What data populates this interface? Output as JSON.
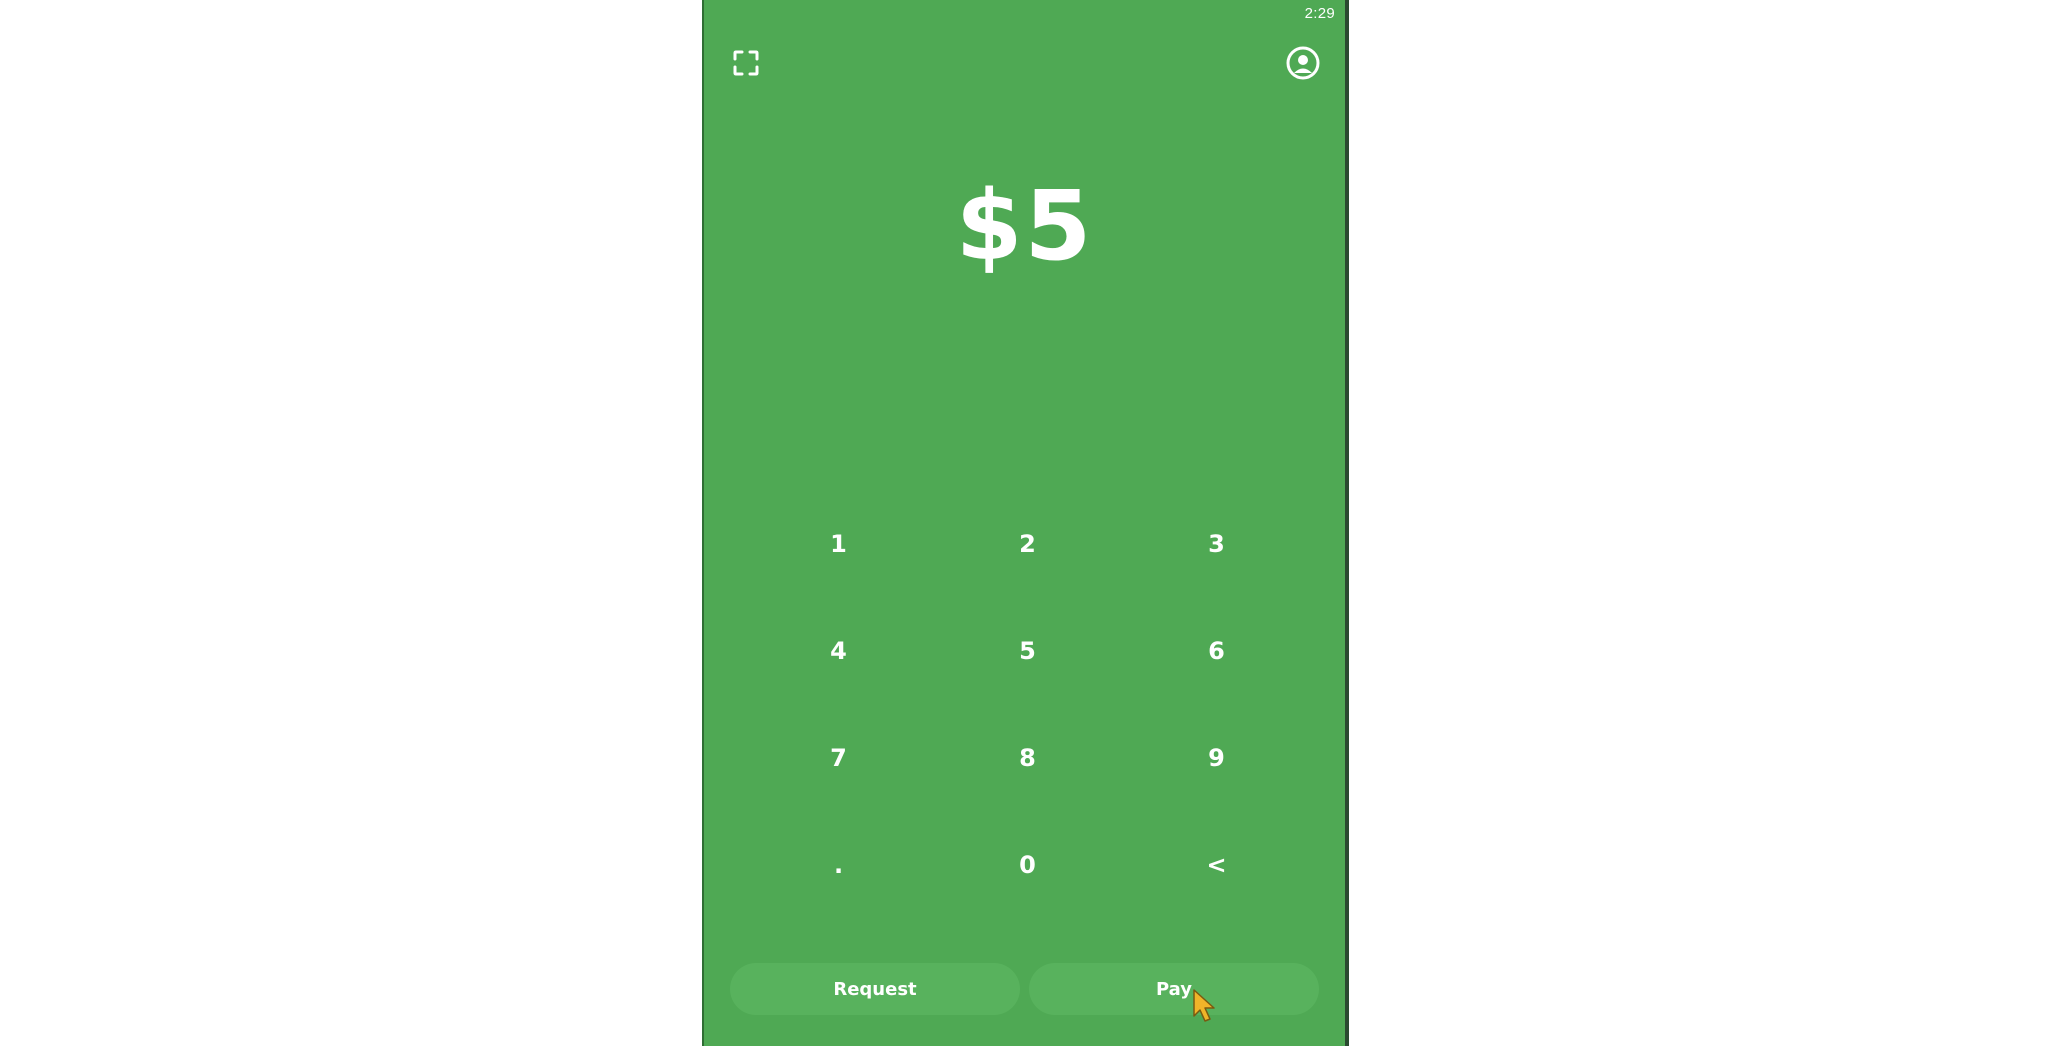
{
  "status_bar": {
    "time": "2:29"
  },
  "header": {
    "scan_icon": "scan-frame-icon",
    "profile_icon": "profile-circle-icon"
  },
  "amount": {
    "display": "$5"
  },
  "keypad": {
    "keys": [
      "1",
      "2",
      "3",
      "4",
      "5",
      "6",
      "7",
      "8",
      "9",
      ".",
      "0",
      "<"
    ]
  },
  "actions": {
    "request_label": "Request",
    "pay_label": "Pay"
  },
  "colors": {
    "background": "#4fa954",
    "button": "#58b25d",
    "text": "#ffffff",
    "cursor": "#f0b429"
  }
}
